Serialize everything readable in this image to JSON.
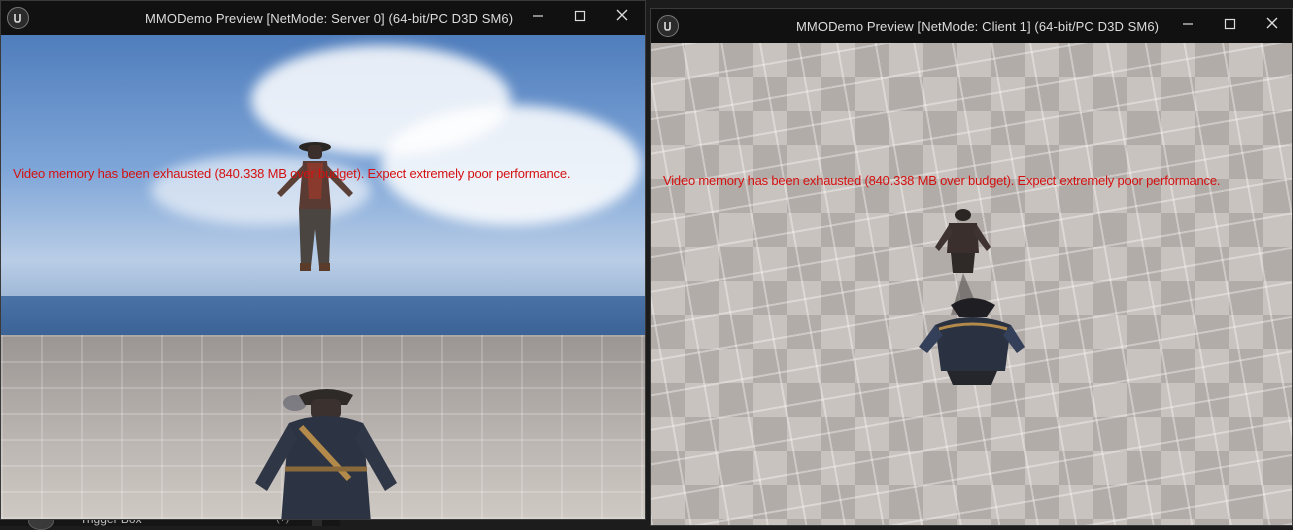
{
  "background_editor": {
    "item_label": "Trigger Box",
    "help_text": "(?)"
  },
  "server_window": {
    "title": "MMODemo Preview [NetMode: Server 0]  (64-bit/PC D3D SM6)",
    "logo_icon": "unreal-logo-icon",
    "warning": "Video memory has been exhausted (840.338 MB over budget). Expect extremely poor performance."
  },
  "client_window": {
    "title": "MMODemo Preview [NetMode: Client 1]  (64-bit/PC D3D SM6)",
    "logo_icon": "unreal-logo-icon",
    "warning": "Video memory has been exhausted (840.338 MB over budget). Expect extremely poor performance."
  },
  "window_controls": [
    "minimize-icon",
    "maximize-icon",
    "close-icon"
  ],
  "colors": {
    "titlebar": "#111111",
    "warning_text": "#d41111",
    "sky": "#7fa6d8",
    "floor": "#c9c3bf"
  }
}
